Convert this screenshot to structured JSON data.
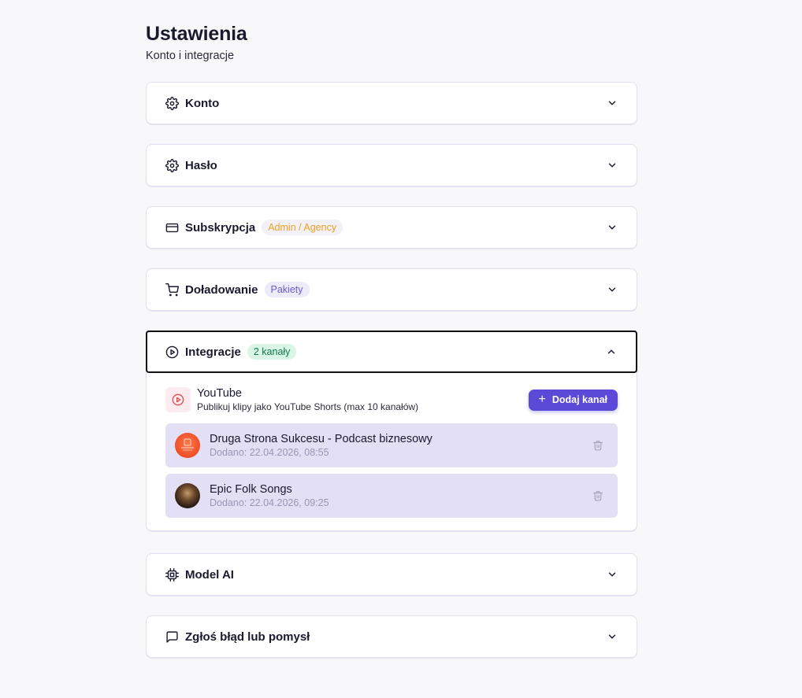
{
  "header": {
    "title": "Ustawienia",
    "subtitle": "Konto i integracje"
  },
  "sections": {
    "konto": {
      "title": "Konto",
      "icon": "gear-icon"
    },
    "haslo": {
      "title": "Hasło",
      "icon": "gear-icon"
    },
    "subskrypcja": {
      "title": "Subskrypcja",
      "icon": "credit-card-icon",
      "badge": "Admin / Agency"
    },
    "doladowanie": {
      "title": "Doładowanie",
      "icon": "cart-icon",
      "badge": "Pakiety"
    },
    "integracje": {
      "title": "Integracje",
      "icon": "play-circle-icon",
      "badge": "2 kanały",
      "expanded": true,
      "youtube": {
        "name": "YouTube",
        "description": "Publikuj klipy jako YouTube Shorts (max 10 kanałów)",
        "add_button": "Dodaj kanał"
      },
      "channels": [
        {
          "name": "Druga Strona Sukcesu - Podcast biznesowy",
          "added": "Dodano: 22.04.2026, 08:55"
        },
        {
          "name": "Epic Folk Songs",
          "added": "Dodano: 22.04.2026, 09:25"
        }
      ]
    },
    "model_ai": {
      "title": "Model AI",
      "icon": "cpu-chip-icon"
    },
    "zglos": {
      "title": "Zgłoś błąd lub pomysł",
      "icon": "message-square-icon"
    }
  },
  "colors": {
    "accent": "#5b4ad8",
    "badge_orange_text": "#f0a020",
    "badge_green_bg": "#d8f5e6",
    "channel_row_bg": "#e3dff4",
    "youtube_red": "#e5484d"
  }
}
